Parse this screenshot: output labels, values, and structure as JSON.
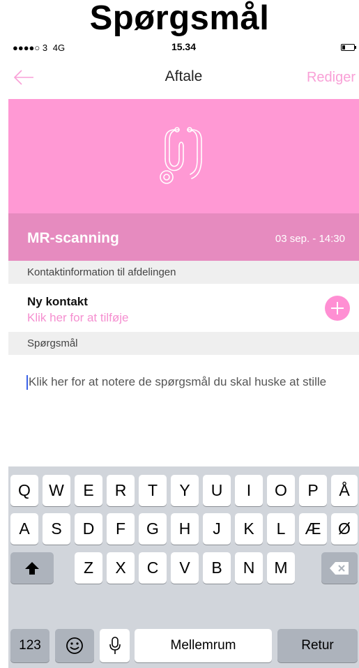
{
  "page_heading": "Spørgsmål",
  "status_bar": {
    "signal": "●●●●○ 3",
    "network": "4G",
    "time": "15.34"
  },
  "nav": {
    "back_icon": "arrow-left-icon",
    "title": "Aftale",
    "edit_label": "Rediger"
  },
  "colors": {
    "accent": "#f9a0d7",
    "hero": "#ff99d4",
    "appointment_bar": "#e68bbf"
  },
  "hero": {
    "icon": "stethoscope-icon"
  },
  "appointment": {
    "title": "MR-scanning",
    "date": "03 sep. - 14:30"
  },
  "contact_section": {
    "header": "Kontaktinformation til afdelingen",
    "name": "Ny kontakt",
    "hint": "Klik her for at tilføje",
    "add_icon": "plus-circle-icon"
  },
  "questions_section": {
    "header": "Spørgsmål",
    "placeholder": "Klik her for at notere de spørgsmål du skal huske at stille"
  },
  "keyboard": {
    "row1": [
      "Q",
      "W",
      "E",
      "R",
      "T",
      "Y",
      "U",
      "I",
      "O",
      "P",
      "Å"
    ],
    "row2": [
      "A",
      "S",
      "D",
      "F",
      "G",
      "H",
      "J",
      "K",
      "L",
      "Æ",
      "Ø"
    ],
    "row3": [
      "Z",
      "X",
      "C",
      "V",
      "B",
      "N",
      "M"
    ],
    "numbers_label": "123",
    "space_label": "Mellemrum",
    "return_label": "Retur",
    "shift_icon": "shift-arrow-icon",
    "backspace_icon": "backspace-icon",
    "emoji_icon": "emoji-icon",
    "mic_icon": "microphone-icon"
  }
}
